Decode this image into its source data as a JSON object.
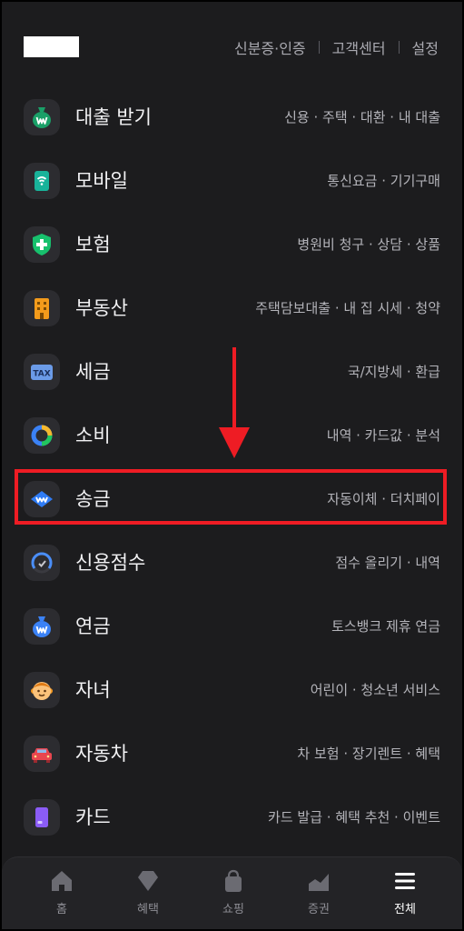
{
  "header": {
    "links": [
      "신분증·인증",
      "고객센터",
      "설정"
    ]
  },
  "menu": [
    {
      "title": "대출 받기",
      "sub": "신용 · 주택 · 대환 · 내 대출",
      "icon": "money-bag-icon",
      "color": "#1aa068"
    },
    {
      "title": "모바일",
      "sub": "통신요금 · 기기구매",
      "icon": "mobile-wifi-icon",
      "color": "#19b39a"
    },
    {
      "title": "보험",
      "sub": "병원비 청구 · 상담 · 상품",
      "icon": "shield-plus-icon",
      "color": "#17c06d"
    },
    {
      "title": "부동산",
      "sub": "주택담보대출 · 내 집 시세 · 청약",
      "icon": "building-icon",
      "color": "#f39b1b"
    },
    {
      "title": "세금",
      "sub": "국/지방세 · 환급",
      "icon": "tax-icon",
      "color": "#6b9be8"
    },
    {
      "title": "소비",
      "sub": "내역 · 카드값 · 분석",
      "icon": "donut-chart-icon",
      "color": "#3b82f6"
    },
    {
      "title": "송금",
      "sub": "자동이체 · 더치페이",
      "icon": "transfer-icon",
      "color": "#2f7cf6"
    },
    {
      "title": "신용점수",
      "sub": "점수 올리기 · 내역",
      "icon": "gauge-icon",
      "color": "#4a8ef8"
    },
    {
      "title": "연금",
      "sub": "토스뱅크 제휴 연금",
      "icon": "pension-bag-icon",
      "color": "#3b82f6"
    },
    {
      "title": "자녀",
      "sub": "어린이 · 청소년 서비스",
      "icon": "child-face-icon",
      "color": "#f59a23"
    },
    {
      "title": "자동차",
      "sub": "차 보험 · 장기렌트 · 혜택",
      "icon": "car-icon",
      "color": "#e8464f"
    },
    {
      "title": "카드",
      "sub": "카드 발급 · 혜택 추천 · 이벤트",
      "icon": "card-icon",
      "color": "#8b5cf6"
    }
  ],
  "tabs": [
    {
      "label": "홈",
      "icon": "home-icon",
      "active": false
    },
    {
      "label": "혜택",
      "icon": "diamond-icon",
      "active": false
    },
    {
      "label": "쇼핑",
      "icon": "shopping-bag-icon",
      "active": false
    },
    {
      "label": "증권",
      "icon": "stock-chart-icon",
      "active": false
    },
    {
      "label": "전체",
      "icon": "menu-icon",
      "active": true
    }
  ],
  "annotation": {
    "highlight_color": "#ee1c24",
    "highlighted_item": "송금"
  }
}
